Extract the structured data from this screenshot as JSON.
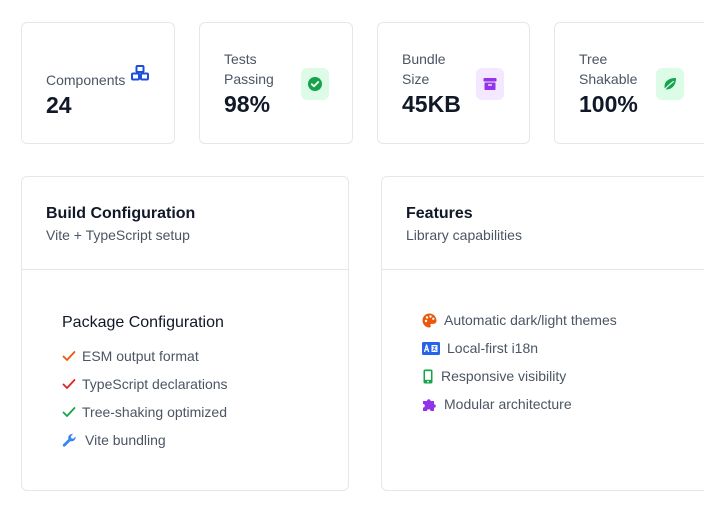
{
  "stats": [
    {
      "label_line1": "Components",
      "label_line2": "",
      "value": "24",
      "icon": "cubes-icon"
    },
    {
      "label_line1": "Tests",
      "label_line2": "Passing",
      "value": "98%",
      "icon": "check-circle-icon"
    },
    {
      "label_line1": "Bundle",
      "label_line2": "Size",
      "value": "45KB",
      "icon": "archive-icon"
    },
    {
      "label_line1": "Tree",
      "label_line2": "Shakable",
      "value": "100%",
      "icon": "leaf-icon"
    }
  ],
  "build": {
    "title": "Build Configuration",
    "subtitle": "Vite + TypeScript setup",
    "package_title": "Package Configuration",
    "items": [
      {
        "label": "ESM output format",
        "icon": "check-icon"
      },
      {
        "label": "TypeScript declarations",
        "icon": "check-icon"
      },
      {
        "label": "Tree-shaking optimized",
        "icon": "check-icon"
      },
      {
        "label": "Vite bundling",
        "icon": "wrench-icon"
      }
    ]
  },
  "features": {
    "title": "Features",
    "subtitle": "Library capabilities",
    "items": [
      {
        "label": "Automatic dark/light themes",
        "icon": "palette-icon"
      },
      {
        "label": "Local-first i18n",
        "icon": "language-icon"
      },
      {
        "label": "Responsive visibility",
        "icon": "mobile-icon"
      },
      {
        "label": "Modular architecture",
        "icon": "puzzle-icon"
      }
    ]
  },
  "colors": {
    "blue": "#1d4ed8",
    "green": "#16a34a",
    "purple": "#9333ea",
    "orange": "#ea580c",
    "red": "#dc2626",
    "wrench_blue": "#3b82f6"
  }
}
